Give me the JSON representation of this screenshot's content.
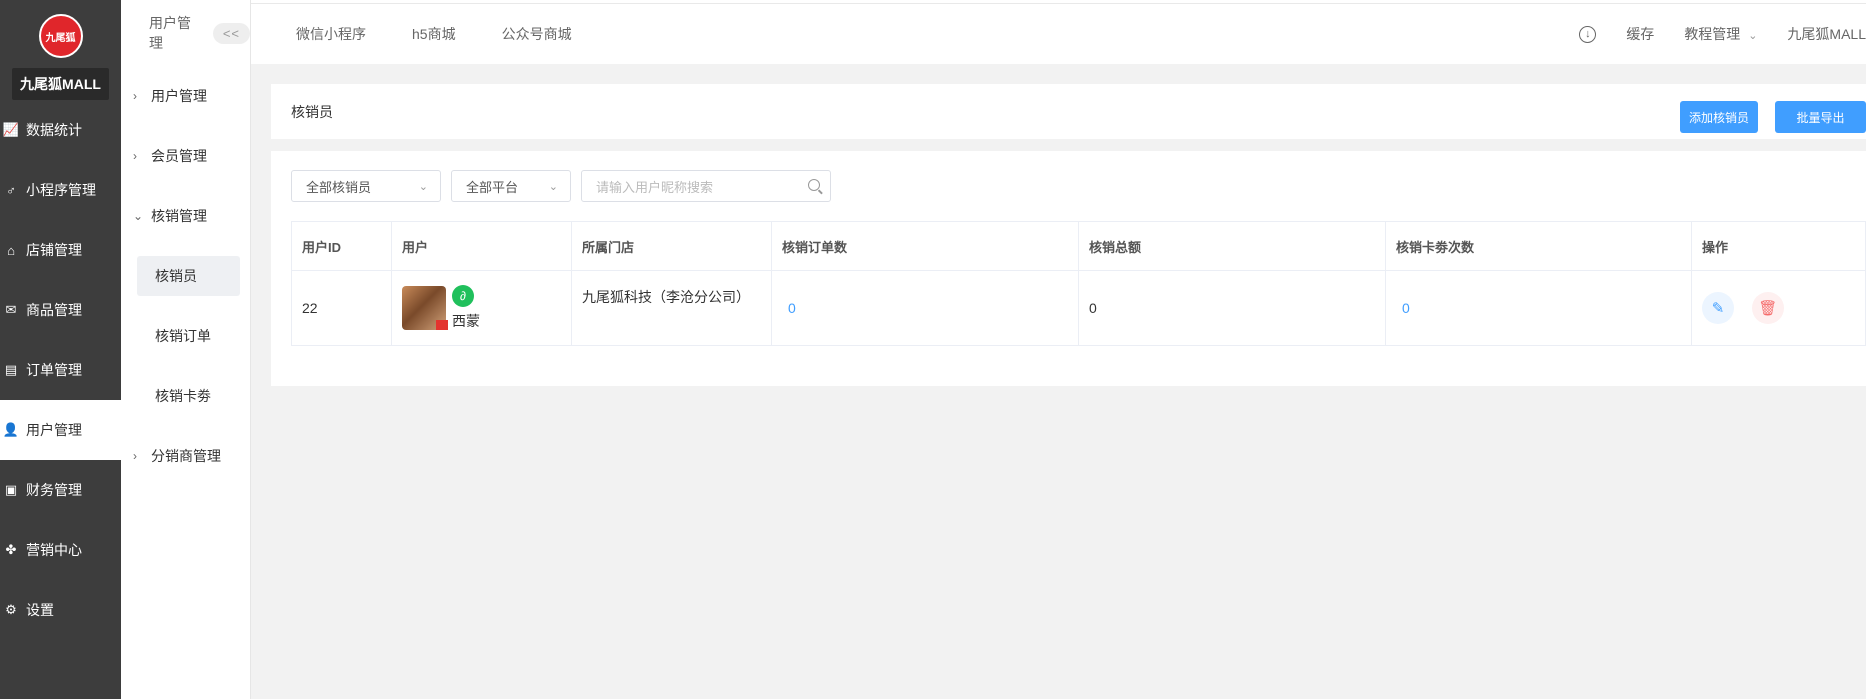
{
  "sidebar": {
    "logo_text": "九尾狐",
    "brand": "九尾狐MALL",
    "items": [
      {
        "label": "数据统计",
        "icon": "chart-line-icon"
      },
      {
        "label": "小程序管理",
        "icon": "mini-program-icon"
      },
      {
        "label": "店铺管理",
        "icon": "store-icon"
      },
      {
        "label": "商品管理",
        "icon": "goods-icon"
      },
      {
        "label": "订单管理",
        "icon": "order-icon"
      },
      {
        "label": "用户管理",
        "icon": "user-icon"
      },
      {
        "label": "财务管理",
        "icon": "finance-icon"
      },
      {
        "label": "营销中心",
        "icon": "marketing-icon"
      },
      {
        "label": "设置",
        "icon": "gear-icon"
      }
    ]
  },
  "subside": {
    "title": "用户管理",
    "collapse": "<<",
    "groups": [
      {
        "label": "用户管理"
      },
      {
        "label": "会员管理"
      },
      {
        "label": "核销管理"
      },
      {
        "label": "分销商管理"
      }
    ],
    "items": [
      {
        "label": "核销员"
      },
      {
        "label": "核销订单"
      },
      {
        "label": "核销卡劵"
      }
    ]
  },
  "topbar": {
    "tabs": [
      "微信小程序",
      "h5商城",
      "公众号商城"
    ],
    "cache": "缓存",
    "tutorial": "教程管理",
    "account": "九尾狐MALL"
  },
  "page": {
    "title": "核销员",
    "add_button": "添加核销员",
    "export_button": "批量导出"
  },
  "filters": {
    "clerk_select": "全部核销员",
    "platform_select": "全部平台",
    "search_placeholder": "请输入用户昵称搜索"
  },
  "table": {
    "headers": [
      "用户ID",
      "用户",
      "所属门店",
      "核销订单数",
      "核销总额",
      "核销卡劵次数",
      "操作"
    ],
    "rows": [
      {
        "id": "22",
        "nickname": "西蒙",
        "store": "九尾狐科技（李沧分公司）",
        "orders": "0",
        "total": "0",
        "cards": "0"
      }
    ]
  },
  "colors": {
    "primary": "#409eff",
    "sidebar_bg": "#3d3d3d",
    "wechat_green": "#20c05c",
    "danger": "#f56c6c"
  }
}
